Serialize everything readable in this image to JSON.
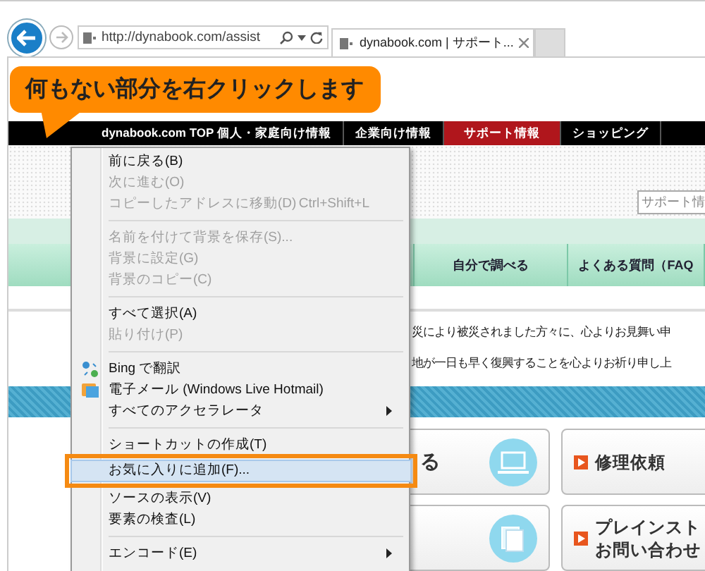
{
  "browser": {
    "address": "http://dynabook.com/assist",
    "tab": {
      "title": "dynabook.com | サポート..."
    }
  },
  "callout": {
    "text": "何もない部分を右クリックします"
  },
  "nav": [
    {
      "label": "dynabook.com TOP 個人・家庭向け情報",
      "selected": false
    },
    {
      "label": "企業向け情報",
      "selected": false
    },
    {
      "label": "サポート情報",
      "selected": true
    },
    {
      "label": "ショッピング",
      "selected": false
    }
  ],
  "search": {
    "value": "サポート情"
  },
  "tabs": [
    {
      "label": "自分で調べる"
    },
    {
      "label": "よくある質問（FAQ"
    }
  ],
  "notice": [
    "災により被災されました方々に、心よりお見舞い申",
    "地が一日も早く復興することを心よりお祈り申し上"
  ],
  "cards": [
    {
      "kind": "laptop",
      "text": "る"
    },
    {
      "kind": "link",
      "lines": [
        "修理依頼"
      ]
    },
    {
      "kind": "document"
    },
    {
      "kind": "link",
      "lines": [
        "プレインスト",
        "お問い合わせ"
      ]
    }
  ],
  "menu": [
    {
      "kind": "item",
      "label": "前に戻る(B)",
      "disabled": false,
      "selected": false,
      "submenu": false
    },
    {
      "kind": "item",
      "label": "次に進む(O)",
      "disabled": true,
      "selected": false,
      "submenu": false
    },
    {
      "kind": "item",
      "label": "コピーしたアドレスに移動(D)",
      "shortcut": "Ctrl+Shift+L",
      "disabled": true,
      "selected": false,
      "submenu": false
    },
    {
      "kind": "separator"
    },
    {
      "kind": "item",
      "label": "名前を付けて背景を保存(S)...",
      "disabled": true,
      "selected": false,
      "submenu": false
    },
    {
      "kind": "item",
      "label": "背景に設定(G)",
      "disabled": true,
      "selected": false,
      "submenu": false
    },
    {
      "kind": "item",
      "label": "背景のコピー(C)",
      "disabled": true,
      "selected": false,
      "submenu": false
    },
    {
      "kind": "separator"
    },
    {
      "kind": "item",
      "label": "すべて選択(A)",
      "disabled": false,
      "selected": false,
      "submenu": false
    },
    {
      "kind": "item",
      "label": "貼り付け(P)",
      "disabled": true,
      "selected": false,
      "submenu": false
    },
    {
      "kind": "separator"
    },
    {
      "kind": "translate",
      "label": "Bing で翻訳",
      "disabled": false,
      "selected": false,
      "submenu": false
    },
    {
      "kind": "mail",
      "label": "電子メール (Windows Live Hotmail)",
      "disabled": false,
      "selected": false,
      "submenu": false
    },
    {
      "kind": "item",
      "label": "すべてのアクセラレータ",
      "disabled": false,
      "selected": false,
      "submenu": true
    },
    {
      "kind": "separator"
    },
    {
      "kind": "item",
      "label": "ショートカットの作成(T)",
      "disabled": false,
      "selected": false,
      "submenu": false
    },
    {
      "kind": "item",
      "label": "お気に入りに追加(F)...",
      "disabled": false,
      "selected": true,
      "submenu": false
    },
    {
      "kind": "item",
      "label": "ソースの表示(V)",
      "disabled": false,
      "selected": false,
      "submenu": false
    },
    {
      "kind": "item",
      "label": "要素の検査(L)",
      "disabled": false,
      "selected": false,
      "submenu": false
    },
    {
      "kind": "separator"
    },
    {
      "kind": "item",
      "label": "エンコード(E)",
      "disabled": false,
      "selected": false,
      "submenu": true
    }
  ]
}
